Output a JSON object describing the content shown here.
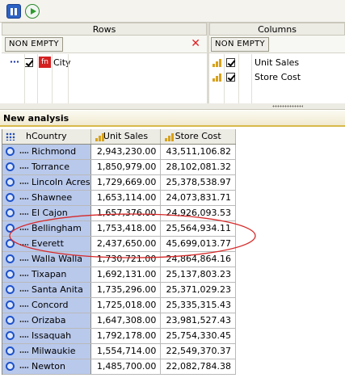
{
  "toolbar": {
    "buttons": [
      {
        "icon": "pause-icon"
      },
      {
        "icon": "play-icon"
      }
    ]
  },
  "rows_pane": {
    "title": "Rows",
    "non_empty_label": "NON EMPTY",
    "remove_icon": "close-icon",
    "fields": [
      {
        "label": "City",
        "checked": true,
        "icon": "function-icon",
        "icon_text": "fn"
      }
    ]
  },
  "columns_pane": {
    "title": "Columns",
    "non_empty_label": "NON EMPTY",
    "fields": [
      {
        "label": "Unit Sales",
        "checked": true,
        "icon": "measure-icon"
      },
      {
        "label": "Store Cost",
        "checked": true,
        "icon": "measure-icon"
      }
    ]
  },
  "analysis": {
    "title": "New analysis",
    "headers": {
      "row_header": "hCountry",
      "col1": "Unit Sales",
      "col2": "Store Cost"
    },
    "rows": [
      {
        "city": "Richmond",
        "unit_sales": "2,943,230.00",
        "store_cost": "43,511,106.82"
      },
      {
        "city": "Torrance",
        "unit_sales": "1,850,979.00",
        "store_cost": "28,102,081.32"
      },
      {
        "city": "Lincoln Acres",
        "unit_sales": "1,729,669.00",
        "store_cost": "25,378,538.97"
      },
      {
        "city": "Shawnee",
        "unit_sales": "1,653,114.00",
        "store_cost": "24,073,831.71"
      },
      {
        "city": "El Cajon",
        "unit_sales": "1,657,376.00",
        "store_cost": "24,926,093.53"
      },
      {
        "city": "Bellingham",
        "unit_sales": "1,753,418.00",
        "store_cost": "25,564,934.11"
      },
      {
        "city": "Everett",
        "unit_sales": "2,437,650.00",
        "store_cost": "45,699,013.77"
      },
      {
        "city": "Walla Walla",
        "unit_sales": "1,730,721.00",
        "store_cost": "24,864,864.16"
      },
      {
        "city": "Tixapan",
        "unit_sales": "1,692,131.00",
        "store_cost": "25,137,803.23"
      },
      {
        "city": "Santa Anita",
        "unit_sales": "1,735,296.00",
        "store_cost": "25,371,029.23"
      },
      {
        "city": "Concord",
        "unit_sales": "1,725,018.00",
        "store_cost": "25,335,315.43"
      },
      {
        "city": "Orizaba",
        "unit_sales": "1,647,308.00",
        "store_cost": "23,981,527.43"
      },
      {
        "city": "Issaquah",
        "unit_sales": "1,792,178.00",
        "store_cost": "25,754,330.45"
      },
      {
        "city": "Milwaukie",
        "unit_sales": "1,554,714.00",
        "store_cost": "22,549,370.37"
      },
      {
        "city": "Newton",
        "unit_sales": "1,485,700.00",
        "store_cost": "22,082,784.38"
      }
    ],
    "highlight_color": "#d62828"
  }
}
